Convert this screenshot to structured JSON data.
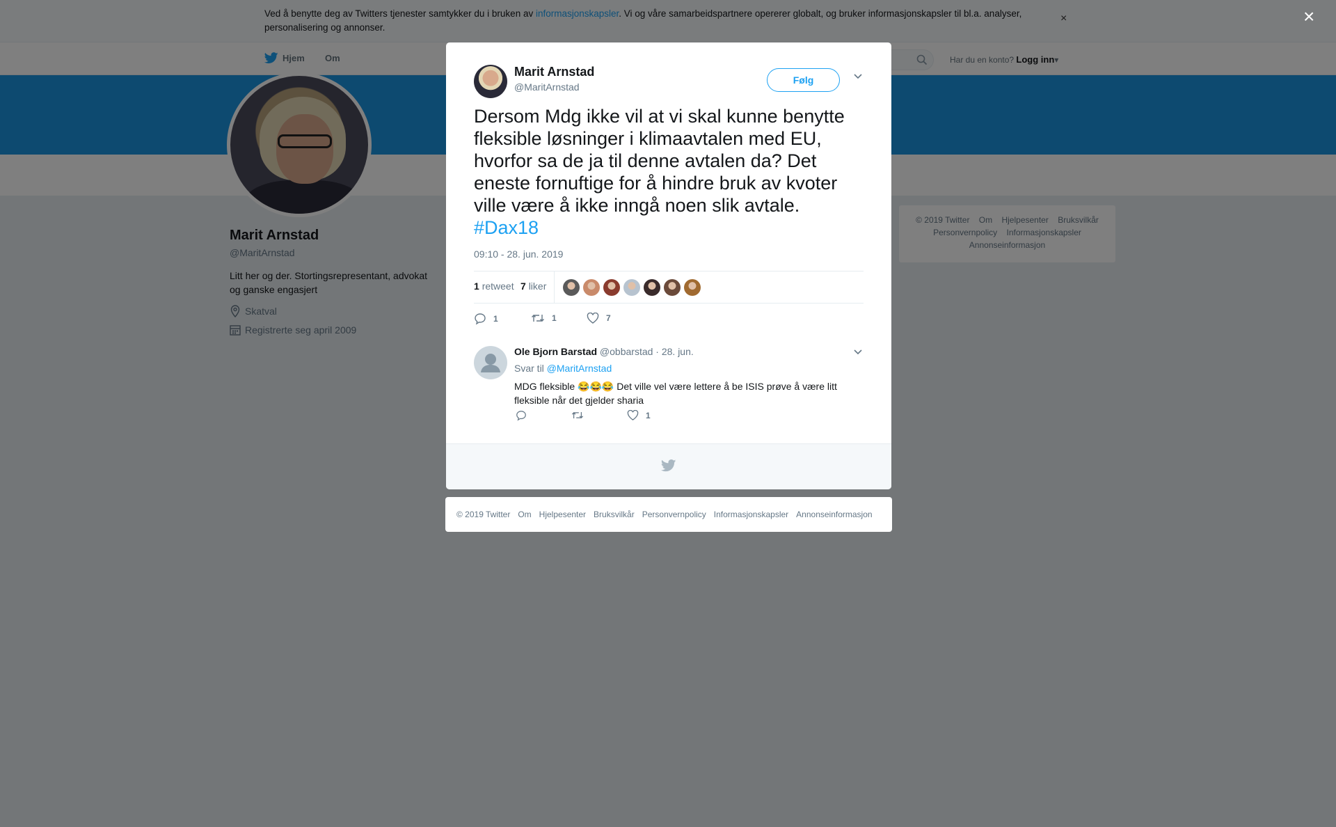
{
  "cookie_banner": {
    "text_before": "Ved å benytte deg av Twitters tjenester samtykker du i bruken av ",
    "link": "informasjonskapsler",
    "text_after": ". Vi og våre samarbeidspartnere opererer globalt, og bruker informasjonskapsler til bl.a. analyser, personalisering og annonser.",
    "close": "×"
  },
  "nav": {
    "home": "Hjem",
    "about": "Om",
    "account_prompt": "Har du en konto?",
    "login": "Logg inn"
  },
  "profile": {
    "name": "Marit Arnstad",
    "handle": "@MaritArnstad",
    "bio": "Litt her og der. Stortingsrepresentant, advokat og ganske engasjert",
    "location": "Skatval",
    "joined": "Registrerte seg april 2009"
  },
  "side_footer": {
    "items": [
      "© 2019 Twitter",
      "Om",
      "Hjelpesenter",
      "Bruksvilkår",
      "Personvernpolicy",
      "Informasjonskapsler",
      "Annonseinformasjon"
    ]
  },
  "overlay": {
    "close": "×"
  },
  "tweet": {
    "author_name": "Marit Arnstad",
    "author_handle": "@MaritArnstad",
    "follow": "Følg",
    "text": "Dersom Mdg ikke vil at vi skal kunne benytte fleksible løsninger i klimaavtalen med EU, hvorfor sa de ja til denne avtalen da? Det eneste fornuftige for å hindre bruk av kvoter ville være å ikke inngå noen slik avtale.",
    "hashtag": "#Dax18",
    "timestamp": "09:10 - 28. jun. 2019",
    "retweet_count": "1",
    "retweet_label": "retweet",
    "like_count": "7",
    "like_label": "liker",
    "actions": {
      "replies": "1",
      "retweets": "1",
      "likes": "7"
    },
    "liker_avatar_colors": [
      "#5a5a5a",
      "#c98a6a",
      "#8a3b2e",
      "#b7c3cf",
      "#3a2b2b",
      "#6b4a3a",
      "#a06a30"
    ]
  },
  "reply": {
    "name": "Ole Bjorn Barstad",
    "handle": "@obbarstad",
    "date": "· 28. jun.",
    "reply_to_label": "Svar til",
    "reply_to_handle": "@MaritArnstad",
    "text": "MDG fleksible 😂😂😂 Det ville vel være lettere å be ISIS prøve å være litt fleksible når det gjelder sharia",
    "actions": {
      "likes": "1"
    }
  },
  "modal_footer": {
    "items": [
      "© 2019 Twitter",
      "Om",
      "Hjelpesenter",
      "Bruksvilkår",
      "Personvernpolicy",
      "Informasjonskapsler",
      "Annonseinformasjon"
    ]
  },
  "colors": {
    "brand": "#1da1f2",
    "banner": "#1b95e0",
    "muted": "#657786"
  }
}
